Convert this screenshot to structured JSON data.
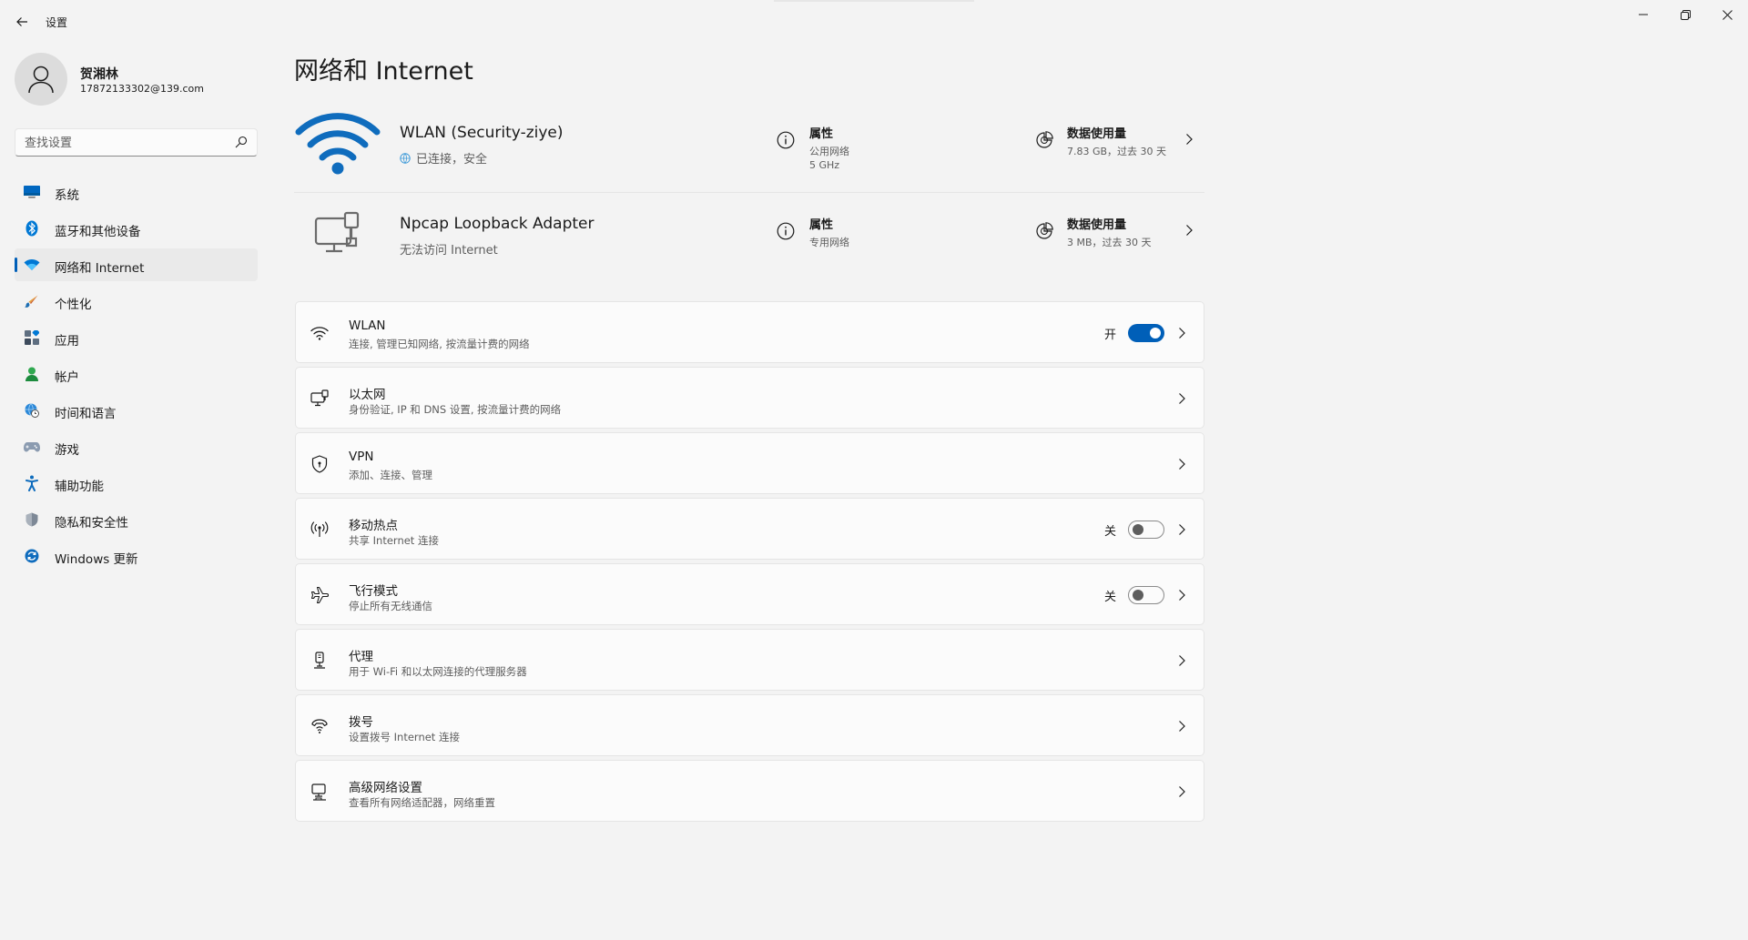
{
  "window": {
    "title": "设置"
  },
  "profile": {
    "name": "贺湘林",
    "email": "17872133302@139.com"
  },
  "search": {
    "placeholder": "查找设置"
  },
  "sidebar": {
    "items": [
      {
        "label": "系统",
        "icon": "system-icon",
        "active": false
      },
      {
        "label": "蓝牙和其他设备",
        "icon": "bluetooth-icon",
        "active": false
      },
      {
        "label": "网络和 Internet",
        "icon": "network-icon",
        "active": true
      },
      {
        "label": "个性化",
        "icon": "brush-icon",
        "active": false
      },
      {
        "label": "应用",
        "icon": "apps-icon",
        "active": false
      },
      {
        "label": "帐户",
        "icon": "account-icon",
        "active": false
      },
      {
        "label": "时间和语言",
        "icon": "globe-clock-icon",
        "active": false
      },
      {
        "label": "游戏",
        "icon": "gamepad-icon",
        "active": false
      },
      {
        "label": "辅助功能",
        "icon": "accessibility-icon",
        "active": false
      },
      {
        "label": "隐私和安全性",
        "icon": "shield-icon",
        "active": false
      },
      {
        "label": "Windows 更新",
        "icon": "update-icon",
        "active": false
      }
    ]
  },
  "main": {
    "title": "网络和 Internet",
    "connections": [
      {
        "name": "WLAN (Security-ziye)",
        "status": "已连接，安全",
        "properties_label": "属性",
        "network_type": "公用网络",
        "band": "5 GHz",
        "data_label": "数据使用量",
        "data_value": "7.83 GB，过去 30 天"
      },
      {
        "name": "Npcap Loopback Adapter",
        "status": "无法访问 Internet",
        "properties_label": "属性",
        "network_type": "专用网络",
        "data_label": "数据使用量",
        "data_value": "3 MB，过去 30 天"
      }
    ],
    "cards": [
      {
        "title": "WLAN",
        "subtitle": "连接, 管理已知网络, 按流量计费的网络",
        "state": "开",
        "toggle": true
      },
      {
        "title": "以太网",
        "subtitle": "身份验证, IP 和 DNS 设置, 按流量计费的网络"
      },
      {
        "title": "VPN",
        "subtitle": "添加、连接、管理"
      },
      {
        "title": "移动热点",
        "subtitle": "共享 Internet 连接",
        "state": "关",
        "toggle": false
      },
      {
        "title": "飞行模式",
        "subtitle": "停止所有无线通信",
        "state": "关",
        "toggle": false
      },
      {
        "title": "代理",
        "subtitle": "用于 Wi-Fi 和以太网连接的代理服务器"
      },
      {
        "title": "拨号",
        "subtitle": "设置拨号 Internet 连接"
      },
      {
        "title": "高级网络设置",
        "subtitle": "查看所有网络适配器，网络重置"
      }
    ]
  },
  "colors": {
    "accent": "#005fb8",
    "background": "#f3f3f3",
    "card": "#fbfbfb"
  }
}
